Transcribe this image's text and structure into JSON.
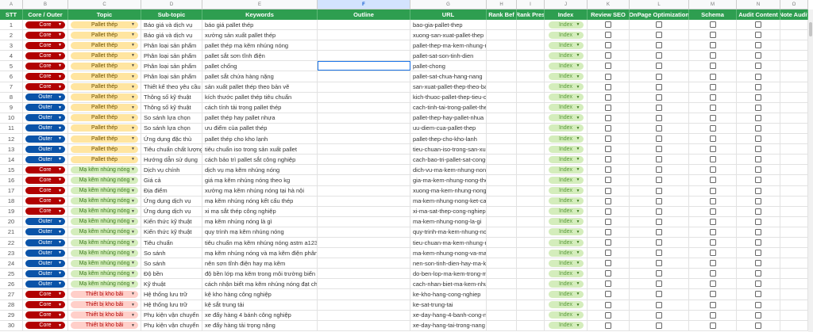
{
  "column_letters": [
    "A",
    "B",
    "C",
    "D",
    "E",
    "F",
    "G",
    "H",
    "I",
    "J",
    "K",
    "L",
    "M",
    "N",
    "O"
  ],
  "selected_column": "F",
  "headers": [
    "STT",
    "Core / Outer",
    "Topic",
    "Sub-topic",
    "Keywords",
    "Outline",
    "URL",
    "Rank Bef",
    "Rank Pres",
    "Index",
    "Review SEO",
    "OnPage Optimization",
    "Schema",
    "Audit Content",
    "Note Audit"
  ],
  "colors": {
    "header_green": "#2e9e50",
    "core": "#b10202",
    "outer": "#0a53a8",
    "topic_pallet": "#ffe5a0",
    "topic_ma_kem": "#d4edbc",
    "topic_kho_bai": "#ffcfc9",
    "index_chip": "#d4edbc"
  },
  "selected_cell": "F5",
  "rows": [
    {
      "stt": "1",
      "type": "Core",
      "topic": "Pallet thép",
      "subtopic": "Báo giá và dịch vụ",
      "keyword": "báo giá pallet thép",
      "url": "bao-gia-pallet-thep",
      "index": "Index"
    },
    {
      "stt": "2",
      "type": "Core",
      "topic": "Pallet thép",
      "subtopic": "Báo giá và dịch vụ",
      "keyword": "xưởng sản xuất pallet thép",
      "url": "xuong-san-xuat-pallet-thep",
      "index": "Index"
    },
    {
      "stt": "3",
      "type": "Core",
      "topic": "Pallet thép",
      "subtopic": "Phân loại sản phẩm",
      "keyword": "pallet thép mạ kẽm nhúng nóng",
      "url": "pallet-thep-ma-kem-nhung-non",
      "index": "Index"
    },
    {
      "stt": "4",
      "type": "Core",
      "topic": "Pallet thép",
      "subtopic": "Phân loại sản phẩm",
      "keyword": "pallet sắt sơn tĩnh điện",
      "url": "pallet-sat-son-tinh-dien",
      "index": "Index"
    },
    {
      "stt": "5",
      "type": "Core",
      "topic": "Pallet thép",
      "subtopic": "Phân loại sản phẩm",
      "keyword": "pallet chống",
      "url": "pallet-chong",
      "index": "Index"
    },
    {
      "stt": "6",
      "type": "Core",
      "topic": "Pallet thép",
      "subtopic": "Phân loại sản phẩm",
      "keyword": "pallet sắt chứa hàng nặng",
      "url": "pallet-sat-chua-hang-nang",
      "index": "Index"
    },
    {
      "stt": "7",
      "type": "Core",
      "topic": "Pallet thép",
      "subtopic": "Thiết kế theo yêu cầu",
      "keyword": "sản xuất pallet thép theo bản vẽ",
      "url": "san-xuat-pallet-thep-theo-ban-v",
      "index": "Index"
    },
    {
      "stt": "8",
      "type": "Outer",
      "topic": "Pallet thép",
      "subtopic": "Thông số kỹ thuật",
      "keyword": "kích thước pallet thép tiêu chuẩn",
      "url": "kich-thuoc-pallet-thep-tieu-chu",
      "index": "Index"
    },
    {
      "stt": "9",
      "type": "Outer",
      "topic": "Pallet thép",
      "subtopic": "Thông số kỹ thuật",
      "keyword": "cách tính tải trọng pallet thép",
      "url": "cach-tinh-tai-trong-pallet-thep",
      "index": "Index"
    },
    {
      "stt": "10",
      "type": "Outer",
      "topic": "Pallet thép",
      "subtopic": "So sánh lựa chọn",
      "keyword": "pallet thép hay pallet nhựa",
      "url": "pallet-thep-hay-pallet-nhua",
      "index": "Index"
    },
    {
      "stt": "11",
      "type": "Outer",
      "topic": "Pallet thép",
      "subtopic": "So sánh lựa chọn",
      "keyword": "ưu điểm của pallet thép",
      "url": "uu-diem-cua-pallet-thep",
      "index": "Index"
    },
    {
      "stt": "12",
      "type": "Outer",
      "topic": "Pallet thép",
      "subtopic": "Ứng dụng đặc thù",
      "keyword": "pallet thép cho kho lạnh",
      "url": "pallet-thep-cho-kho-lanh",
      "index": "Index"
    },
    {
      "stt": "13",
      "type": "Outer",
      "topic": "Pallet thép",
      "subtopic": "Tiêu chuẩn chất lượng",
      "keyword": "tiêu chuẩn iso trong sản xuất pallet",
      "url": "tieu-chuan-iso-trong-san-xuat-p",
      "index": "Index"
    },
    {
      "stt": "14",
      "type": "Outer",
      "topic": "Pallet thép",
      "subtopic": "Hướng dẫn sử dụng",
      "keyword": "cách bảo trì pallet sắt công nghiệp",
      "url": "cach-bao-tri-pallet-sat-cong-ng",
      "index": "Index"
    },
    {
      "stt": "15",
      "type": "Core",
      "topic": "Mạ kẽm nhúng nóng",
      "subtopic": "Dịch vụ chính",
      "keyword": "dịch vụ mạ kẽm nhúng nóng",
      "url": "dich-vu-ma-kem-nhung-nong",
      "index": "Index"
    },
    {
      "stt": "16",
      "type": "Core",
      "topic": "Mạ kẽm nhúng nóng",
      "subtopic": "Giá cả",
      "keyword": "giá mạ kẽm nhúng nóng theo kg",
      "url": "gia-ma-kem-nhung-nong-theo-",
      "index": "Index"
    },
    {
      "stt": "17",
      "type": "Core",
      "topic": "Mạ kẽm nhúng nóng",
      "subtopic": "Địa điểm",
      "keyword": "xưởng mạ kẽm nhúng nóng tại hà nội",
      "url": "xuong-ma-kem-nhung-nong-tai",
      "index": "Index"
    },
    {
      "stt": "18",
      "type": "Core",
      "topic": "Mạ kẽm nhúng nóng",
      "subtopic": "Ứng dụng dịch vụ",
      "keyword": "mạ kẽm nhúng nóng kết cấu thép",
      "url": "ma-kem-nhung-nong-ket-cau-t",
      "index": "Index"
    },
    {
      "stt": "19",
      "type": "Core",
      "topic": "Mạ kẽm nhúng nóng",
      "subtopic": "Ứng dụng dịch vụ",
      "keyword": "xi mạ sắt thép công nghiệp",
      "url": "xi-ma-sat-thep-cong-nghiep",
      "index": "Index"
    },
    {
      "stt": "20",
      "type": "Outer",
      "topic": "Mạ kẽm nhúng nóng",
      "subtopic": "Kiến thức kỹ thuật",
      "keyword": "mạ kẽm nhúng nóng là gì",
      "url": "ma-kem-nhung-nong-la-gi",
      "index": "Index"
    },
    {
      "stt": "21",
      "type": "Outer",
      "topic": "Mạ kẽm nhúng nóng",
      "subtopic": "Kiến thức kỹ thuật",
      "keyword": "quy trình mạ kẽm nhúng nóng",
      "url": "quy-trinh-ma-kem-nhung-nong",
      "index": "Index"
    },
    {
      "stt": "22",
      "type": "Outer",
      "topic": "Mạ kẽm nhúng nóng",
      "subtopic": "Tiêu chuẩn",
      "keyword": "tiêu chuẩn mạ kẽm nhúng nóng astm a123",
      "url": "tieu-chuan-ma-kem-nhung-non",
      "index": "Index"
    },
    {
      "stt": "23",
      "type": "Outer",
      "topic": "Mạ kẽm nhúng nóng",
      "subtopic": "So sánh",
      "keyword": "mạ kẽm nhúng nóng và mạ kẽm điện phân",
      "url": "ma-kem-nhung-nong-va-ma-ke",
      "index": "Index"
    },
    {
      "stt": "24",
      "type": "Outer",
      "topic": "Mạ kẽm nhúng nóng",
      "subtopic": "So sánh",
      "keyword": "nên sơn tĩnh điện hay mạ kẽm",
      "url": "nen-son-tinh-dien-hay-ma-kem",
      "index": "Index"
    },
    {
      "stt": "25",
      "type": "Outer",
      "topic": "Mạ kẽm nhúng nóng",
      "subtopic": "Độ bền",
      "keyword": "độ bền lớp mạ kẽm trong môi trường biển",
      "url": "do-ben-lop-ma-kem-trong-moi-",
      "index": "Index"
    },
    {
      "stt": "26",
      "type": "Outer",
      "topic": "Mạ kẽm nhúng nóng",
      "subtopic": "Kỹ thuật",
      "keyword": "cách nhận biết mạ kẽm nhúng nóng đạt chuẩn",
      "url": "cach-nhan-biet-ma-kem-nhung",
      "index": "Index"
    },
    {
      "stt": "27",
      "type": "Core",
      "topic": "Thiết bị kho bãi",
      "subtopic": "Hệ thống lưu trữ",
      "keyword": "kệ kho hàng công nghiệp",
      "url": "ke-kho-hang-cong-nghiep",
      "index": "Index"
    },
    {
      "stt": "28",
      "type": "Core",
      "topic": "Thiết bị kho bãi",
      "subtopic": "Hệ thống lưu trữ",
      "keyword": "kệ sắt trung tải",
      "url": "ke-sat-trung-tai",
      "index": "Index"
    },
    {
      "stt": "29",
      "type": "Core",
      "topic": "Thiết bị kho bãi",
      "subtopic": "Phụ kiện vận chuyển",
      "keyword": "xe đẩy hàng 4 bánh công nghiệp",
      "url": "xe-day-hang-4-banh-cong-ngh",
      "index": "Index"
    },
    {
      "stt": "30",
      "type": "Core",
      "topic": "Thiết bị kho bãi",
      "subtopic": "Phụ kiện vận chuyển",
      "keyword": "xe đẩy hàng tải trọng nặng",
      "url": "xe-day-hang-tai-trong-nang",
      "index": "Index"
    }
  ]
}
